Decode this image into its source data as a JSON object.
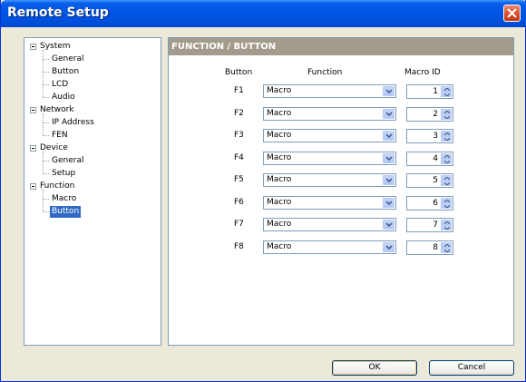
{
  "window": {
    "title": "Remote Setup"
  },
  "tree": {
    "items": [
      {
        "label": "System",
        "level": 0,
        "expanded": true
      },
      {
        "label": "General",
        "level": 1
      },
      {
        "label": "Button",
        "level": 1
      },
      {
        "label": "LCD",
        "level": 1
      },
      {
        "label": "Audio",
        "level": 1
      },
      {
        "label": "Network",
        "level": 0,
        "expanded": true
      },
      {
        "label": "IP Address",
        "level": 1
      },
      {
        "label": "FEN",
        "level": 1
      },
      {
        "label": "Device",
        "level": 0,
        "expanded": true
      },
      {
        "label": "General",
        "level": 1
      },
      {
        "label": "Setup",
        "level": 1
      },
      {
        "label": "Function",
        "level": 0,
        "expanded": true
      },
      {
        "label": "Macro",
        "level": 1
      },
      {
        "label": "Button",
        "level": 1,
        "selected": true
      }
    ]
  },
  "panel": {
    "header": "FUNCTION / BUTTON",
    "columns": {
      "button": "Button",
      "function": "Function",
      "macro_id": "Macro ID"
    },
    "rows": [
      {
        "key": "F1",
        "function": "Macro",
        "macro_id": "1"
      },
      {
        "key": "F2",
        "function": "Macro",
        "macro_id": "2"
      },
      {
        "key": "F3",
        "function": "Macro",
        "macro_id": "3"
      },
      {
        "key": "F4",
        "function": "Macro",
        "macro_id": "4"
      },
      {
        "key": "F5",
        "function": "Macro",
        "macro_id": "5"
      },
      {
        "key": "F6",
        "function": "Macro",
        "macro_id": "6"
      },
      {
        "key": "F7",
        "function": "Macro",
        "macro_id": "7"
      },
      {
        "key": "F8",
        "function": "Macro",
        "macro_id": "8"
      }
    ]
  },
  "footer": {
    "ok_label": "OK",
    "cancel_label": "Cancel"
  },
  "colors": {
    "titlebar": "#0054e3",
    "panel_header": "#a39b8c",
    "selection": "#316ac5"
  }
}
